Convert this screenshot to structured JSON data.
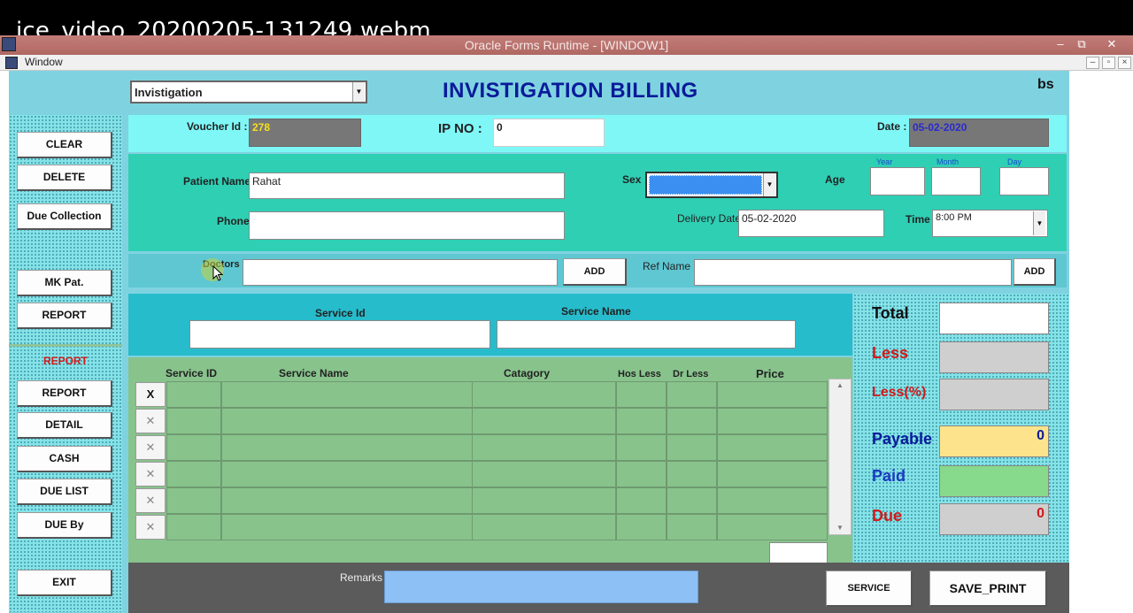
{
  "video": {
    "title": "ice_video_20200205-131249.webm"
  },
  "window": {
    "title": "Oracle Forms Runtime - [WINDOW1]",
    "menu_window": "Window",
    "min": "–",
    "max": "⧉",
    "close": "✕"
  },
  "header": {
    "module_select": "Invistigation",
    "page_title": "INVISTIGATION BILLING",
    "user": "bs"
  },
  "voucher": {
    "voucher_label": "Voucher Id :",
    "voucher_value": "278",
    "ip_label": "IP NO  :",
    "ip_value": "0",
    "date_label": "Date :",
    "date_value": "05-02-2020"
  },
  "patient": {
    "name_label": "Patient Name",
    "name_value": "Rahat",
    "phone_label": "Phone",
    "phone_value": "",
    "sex_label": "Sex",
    "age_label": "Age",
    "year_label": "Year",
    "month_label": "Month",
    "day_label": "Day",
    "delivery_label": "Delivery Date",
    "delivery_value": "05-02-2020",
    "time_label": "Time",
    "time_value": "8:00 PM"
  },
  "doctors": {
    "label": "Doctors",
    "add": "ADD",
    "ref_label": "Ref Name",
    "ref_add": "ADD"
  },
  "service": {
    "id_label": "Service Id",
    "name_label": "Service Name"
  },
  "grid": {
    "columns": [
      "Service ID",
      "Service Name",
      "Catagory",
      "Hos Less",
      "Dr Less",
      "Price"
    ],
    "rows": 6,
    "first_x": "X",
    "x": "✕"
  },
  "left_buttons": {
    "clear": "CLEAR",
    "delete": "DELETE",
    "due_collection": "Due Collection",
    "mk_pat": "MK Pat.",
    "report1": "REPORT",
    "report_heading": "REPORT",
    "report2": "REPORT",
    "detail": "DETAIL",
    "cash": "CASH",
    "due_list": "DUE LIST",
    "due_by": "DUE By",
    "exit": "EXIT"
  },
  "summary": {
    "total_label": "Total",
    "less_label": "Less",
    "less_pct_label": "Less(%)",
    "payable_label": "Payable",
    "payable_value": "0",
    "paid_label": "Paid",
    "due_label": "Due",
    "due_value": "0"
  },
  "bottom": {
    "remarks_label": "Remarks",
    "service_btn": "SERVICE",
    "save_print_btn": "SAVE_PRINT"
  },
  "colors": {
    "title_blue": "#0a1a9a",
    "less_red": "#d11a1a",
    "payable_yellow": "#fde48c",
    "paid_green": "#87d98b"
  }
}
